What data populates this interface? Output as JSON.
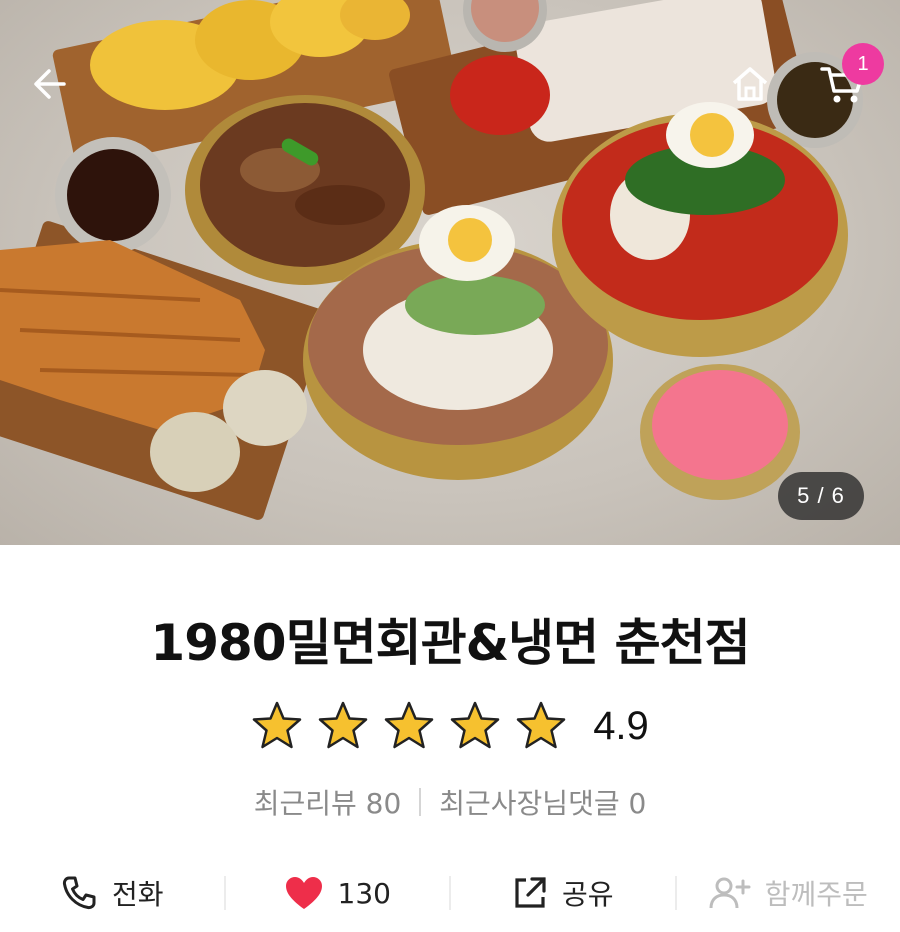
{
  "header": {
    "cart_count": "1",
    "image_counter": "5 / 6"
  },
  "store": {
    "name": "1980밀면회관&냉면 춘천점",
    "rating": "4.9",
    "rating_value": 4.9,
    "stars_total": 5,
    "recent_reviews": "최근리뷰 80",
    "owner_replies": "최근사장님댓글 0"
  },
  "actions": {
    "call": "전화",
    "likes": "130",
    "share": "공유",
    "group_order": "함께주문"
  },
  "colors": {
    "accent": "#ee3aa0",
    "heart": "#ee2e4a",
    "star": "#f6c12f"
  },
  "icons": [
    "back-arrow-icon",
    "home-icon",
    "cart-icon",
    "star-icon",
    "phone-icon",
    "heart-icon",
    "share-icon",
    "add-user-icon"
  ]
}
